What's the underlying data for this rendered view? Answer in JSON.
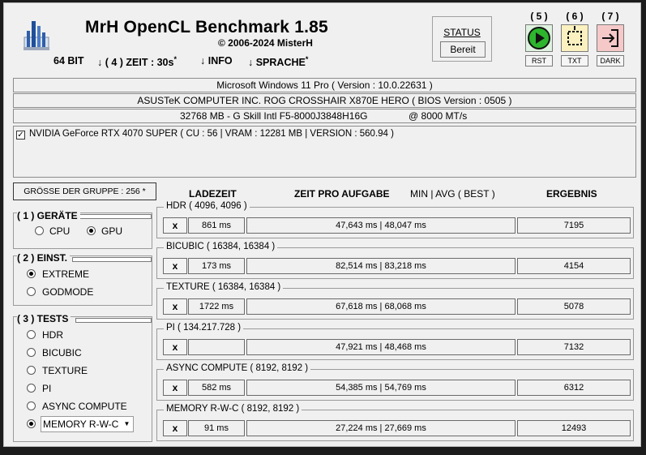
{
  "header": {
    "title": "MrH OpenCL Benchmark 1.85",
    "copyright": "© 2006-2024 MisterH",
    "menu": [
      "64 BIT",
      "↓ ( 4 ) ZEIT : 30s",
      "↓ INFO",
      "↓ SPRACHE"
    ],
    "menu_sup": "*",
    "status_label": "STATUS",
    "status_value": "Bereit",
    "buttons": [
      {
        "num": "( 5 )",
        "label": "RST",
        "icon": "play-icon",
        "color": "#2db52d"
      },
      {
        "num": "( 6 )",
        "label": "TXT",
        "icon": "select-icon",
        "color": "#f4d24a"
      },
      {
        "num": "( 7 )",
        "label": "DARK",
        "icon": "export-icon",
        "color": "#e96b6b"
      }
    ]
  },
  "sysinfo": {
    "os": "Microsoft Windows 11 Pro ( Version : 10.0.22631 )",
    "board": "ASUSTeK COMPUTER INC. ROG CROSSHAIR X870E HERO ( BIOS Version : 0505 )",
    "memory": "32768 MB - G Skill Intl F5-8000J3848H16G",
    "memory_speed": "@ 8000 MT/s",
    "device": "NVIDIA GeForce RTX 4070 SUPER ( CU : 56 | VRAM : 12281 MB | VERSION : 560.94 )"
  },
  "left": {
    "group_size": "GRÖSSE DER GRUPPE : 256 *",
    "devices_title": "( 1 ) GERÄTE",
    "devices": [
      "CPU",
      "GPU"
    ],
    "settings_title": "( 2 ) EINST.",
    "settings": [
      "EXTREME",
      "GODMODE"
    ],
    "tests_title": "( 3 ) TESTS",
    "tests": [
      "HDR",
      "BICUBIC",
      "TEXTURE",
      "PI",
      "ASYNC COMPUTE"
    ],
    "tests_select": "MEMORY R-W-C"
  },
  "columns": {
    "load": "LADEZEIT",
    "time": "ZEIT PRO AUFGABE",
    "minavg": "MIN | AVG ( BEST )",
    "result": "ERGEBNIS"
  },
  "results": [
    {
      "name": "HDR ( 4096, 4096 )",
      "x": "x",
      "load": "861 ms",
      "time": "47,643 ms | 48,047 ms",
      "result": "7195"
    },
    {
      "name": "BICUBIC ( 16384, 16384 )",
      "x": "x",
      "load": "173 ms",
      "time": "82,514 ms | 83,218 ms",
      "result": "4154"
    },
    {
      "name": "TEXTURE ( 16384, 16384 )",
      "x": "x",
      "load": "1722 ms",
      "time": "67,618 ms | 68,068 ms",
      "result": "5078"
    },
    {
      "name": "PI ( 134.217.728 )",
      "x": "x",
      "load": "",
      "time": "47,921 ms | 48,468 ms",
      "result": "7132"
    },
    {
      "name": "ASYNC COMPUTE ( 8192, 8192 )",
      "x": "x",
      "load": "582 ms",
      "time": "54,385 ms | 54,769 ms",
      "result": "6312"
    },
    {
      "name": "MEMORY R-W-C ( 8192, 8192 )",
      "x": "x",
      "load": "91 ms",
      "time": "27,224 ms | 27,669 ms",
      "result": "12493"
    }
  ]
}
